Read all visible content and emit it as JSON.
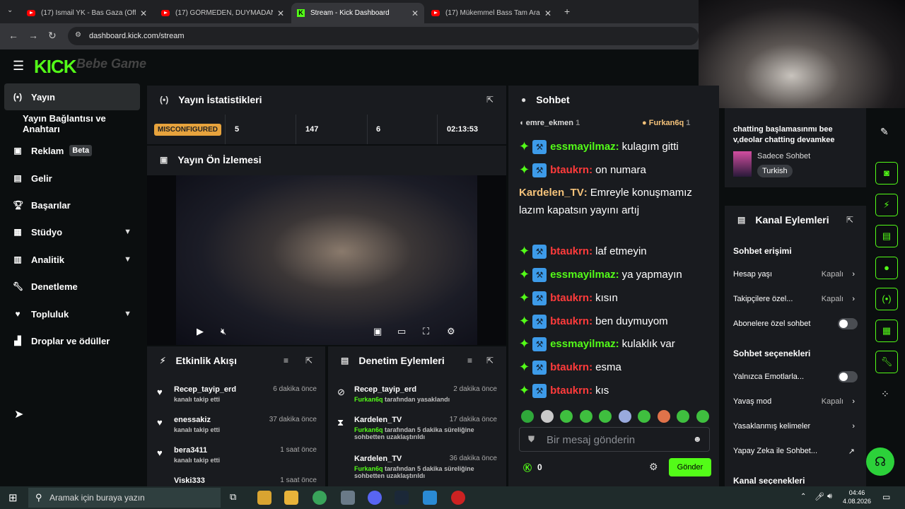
{
  "browser": {
    "tabs": [
      {
        "title": "(17) İsmail YK - Bas Gaza (Offici"
      },
      {
        "title": "(17) GÖRMEDEN, DUYMADAN"
      },
      {
        "title": "Stream - Kick Dashboard"
      },
      {
        "title": "(17) Mükemmel Bass Tam Arab"
      }
    ],
    "url": "dashboard.kick.com/stream"
  },
  "sidebar": {
    "items": [
      {
        "label": "Yayın"
      },
      {
        "label": "Yayın Bağlantısı ve Anahtarı"
      },
      {
        "label": "Reklam",
        "badge": "Beta"
      },
      {
        "label": "Gelir"
      },
      {
        "label": "Başarılar"
      },
      {
        "label": "Stüdyo"
      },
      {
        "label": "Analitik"
      },
      {
        "label": "Denetleme"
      },
      {
        "label": "Topluluk"
      },
      {
        "label": "Droplar ve ödüller"
      }
    ]
  },
  "stats": {
    "title": "Yayın İstatistikleri",
    "status": "MISCONFIGURED",
    "values": [
      "5",
      "147",
      "6",
      "02:13:53"
    ]
  },
  "preview": {
    "title": "Yayın Ön İzlemesi"
  },
  "activity": {
    "title": "Etkinlik Akışı",
    "items": [
      {
        "name": "Recep_tayip_erd",
        "sub": "kanalı takip etti",
        "time": "6 dakika önce"
      },
      {
        "name": "enessakiz",
        "sub": "kanalı takip etti",
        "time": "37 dakika önce"
      },
      {
        "name": "bera3411",
        "sub": "kanalı takip etti",
        "time": "1 saat önce"
      },
      {
        "name": "Viski333",
        "sub": "",
        "time": "1 saat önce"
      }
    ]
  },
  "moderation": {
    "title": "Denetim Eylemleri",
    "items": [
      {
        "name": "Recep_tayip_erd",
        "actor": "Furkan6q",
        "sub": "tarafından yasaklandı",
        "time": "2 dakika önce"
      },
      {
        "name": "Kardelen_TV",
        "actor": "Furkan6q",
        "sub": "tarafından 5 dakika süreliğine sohbetten uzaklaştırıldı",
        "time": "17 dakika önce"
      },
      {
        "name": "Kardelen_TV",
        "actor": "Furkan6q",
        "sub": "tarafından 5 dakika süreliğine sohbetten uzaklaştırıldı",
        "time": "36 dakika önce"
      }
    ]
  },
  "chat": {
    "title": "Sohbet",
    "pinned": [
      {
        "name": "emre_ekmen",
        "count": "1"
      },
      {
        "name": "Furkan6q",
        "count": "1"
      }
    ],
    "messages": [
      {
        "user": "essmayilmaz",
        "text": "kulagım gitti",
        "color": "#53fc18"
      },
      {
        "user": "btaukrn",
        "text": "on numara",
        "color": "#ff3b3b"
      },
      {
        "user": "Kardelen_TV",
        "text": "Emreyle konuşmamız lazım kapatsın yayını artıj",
        "color": "#f4c27a"
      },
      {
        "user": "btaukrn",
        "text": "laf etmeyin",
        "color": "#ff3b3b"
      },
      {
        "user": "essmayilmaz",
        "text": "ya yapmayın",
        "color": "#53fc18"
      },
      {
        "user": "btaukrn",
        "text": "kısın",
        "color": "#ff3b3b"
      },
      {
        "user": "btaukrn",
        "text": "ben duymuyom",
        "color": "#ff3b3b"
      },
      {
        "user": "essmayilmaz",
        "text": "kulaklık var",
        "color": "#53fc18"
      },
      {
        "user": "btaukrn",
        "text": "esma",
        "color": "#ff3b3b"
      },
      {
        "user": "btaukrn",
        "text": "kıs",
        "color": "#ff3b3b"
      }
    ],
    "placeholder": "Bir mesaj gönderin",
    "points": "0",
    "send_label": "Gönder"
  },
  "stream_info": {
    "title": "chatting başlamasınmı bee v,deolar chatting devamkee",
    "category": "Sadece Sohbet",
    "tag": "Turkish"
  },
  "channel_actions": {
    "title": "Kanal Eylemleri",
    "section1": "Sohbet erişimi",
    "rows1": [
      {
        "label": "Hesap yaşı",
        "value": "Kapalı"
      },
      {
        "label": "Takipçilere özel...",
        "value": "Kapalı"
      },
      {
        "label": "Abonelere özel sohbet",
        "value": ""
      }
    ],
    "section2": "Sohbet seçenekleri",
    "rows2": [
      {
        "label": "Yalnızca Emotlarla...",
        "value": ""
      },
      {
        "label": "Yavaş mod",
        "value": "Kapalı"
      },
      {
        "label": "Yasaklanmış kelimeler",
        "value": ""
      },
      {
        "label": "Yapay Zeka ile Sohbet...",
        "value": ""
      }
    ],
    "section3": "Kanal seçenekleri"
  },
  "taskbar": {
    "search_placeholder": "Aramak için buraya yazın",
    "time": "04:46",
    "date": "4.08.2026"
  },
  "colors": {
    "accent": "#53fc18",
    "panel": "#191b1f",
    "background": "#0b0e0f"
  }
}
